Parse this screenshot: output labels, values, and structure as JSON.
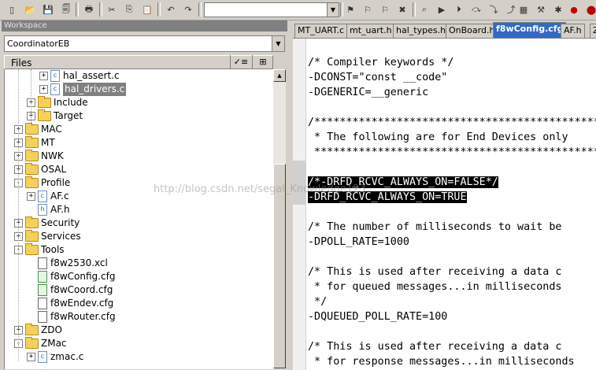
{
  "toolbar": {
    "icons": [
      "new-file",
      "open-folder",
      "save",
      "save-all",
      "print",
      "cut",
      "copy",
      "paste",
      "undo",
      "redo",
      "dropdown",
      "bookmark-toggle",
      "bookmark-next",
      "bookmark-prev",
      "bookmark-clear",
      "find",
      "go",
      "go-next",
      "step",
      "step-into",
      "step-out",
      "compile",
      "make",
      "debug",
      "stop",
      "breakpoint"
    ],
    "search_value": ""
  },
  "workspace": {
    "title": "Workspace",
    "project": "CoordinatorEB",
    "files_header": "Files",
    "tree": [
      {
        "label": "hal_assert.c",
        "kind": "c-file",
        "depth": 3,
        "expander": "+"
      },
      {
        "label": "hal_drivers.c",
        "kind": "c-file",
        "depth": 3,
        "expander": "+",
        "selected": true
      },
      {
        "label": "Include",
        "kind": "folder",
        "depth": 2,
        "expander": "+"
      },
      {
        "label": "Target",
        "kind": "folder",
        "depth": 2,
        "expander": "+"
      },
      {
        "label": "MAC",
        "kind": "folder",
        "depth": 1,
        "expander": "+"
      },
      {
        "label": "MT",
        "kind": "folder",
        "depth": 1,
        "expander": "+"
      },
      {
        "label": "NWK",
        "kind": "folder",
        "depth": 1,
        "expander": "+"
      },
      {
        "label": "OSAL",
        "kind": "folder",
        "depth": 1,
        "expander": "+"
      },
      {
        "label": "Profile",
        "kind": "folder",
        "depth": 1,
        "expander": "-"
      },
      {
        "label": "AF.c",
        "kind": "c-file",
        "depth": 2,
        "expander": "+"
      },
      {
        "label": "AF.h",
        "kind": "h-file",
        "depth": 2,
        "expander": ""
      },
      {
        "label": "Security",
        "kind": "folder",
        "depth": 1,
        "expander": "+"
      },
      {
        "label": "Services",
        "kind": "folder",
        "depth": 1,
        "expander": "+"
      },
      {
        "label": "Tools",
        "kind": "folder",
        "depth": 1,
        "expander": "-"
      },
      {
        "label": "f8w2530.xcl",
        "kind": "xcl-file",
        "depth": 2,
        "expander": ""
      },
      {
        "label": "f8wConfig.cfg",
        "kind": "cfg-file",
        "depth": 2,
        "expander": ""
      },
      {
        "label": "f8wCoord.cfg",
        "kind": "cfg-file",
        "depth": 2,
        "expander": ""
      },
      {
        "label": "f8wEndev.cfg",
        "kind": "x-file",
        "depth": 2,
        "expander": ""
      },
      {
        "label": "f8wRouter.cfg",
        "kind": "x-file",
        "depth": 2,
        "expander": ""
      },
      {
        "label": "ZDO",
        "kind": "folder",
        "depth": 1,
        "expander": "+"
      },
      {
        "label": "ZMac",
        "kind": "folder",
        "depth": 1,
        "expander": "-"
      },
      {
        "label": "zmac.c",
        "kind": "c-file",
        "depth": 2,
        "expander": "+"
      }
    ]
  },
  "editor": {
    "tabs": [
      {
        "label": "MT_UART.c",
        "active": false
      },
      {
        "label": "mt_uart.h",
        "active": false
      },
      {
        "label": "hal_types.h",
        "active": false
      },
      {
        "label": "OnBoard.h",
        "active": false
      },
      {
        "label": "f8wConfig.cfg",
        "active": true
      },
      {
        "label": "AF.h",
        "active": false
      },
      {
        "label": "ZM",
        "active": false
      }
    ],
    "lines": [
      {
        "text": "/* Compiler keywords */",
        "hl": false
      },
      {
        "text": "-DCONST=\"const __code\"",
        "hl": false
      },
      {
        "text": "-DGENERIC=__generic",
        "hl": false
      },
      {
        "text": "",
        "hl": false
      },
      {
        "text": "/**********************************************",
        "hl": false
      },
      {
        "text": " * The following are for End Devices only",
        "hl": false
      },
      {
        "text": " **********************************************",
        "hl": false
      },
      {
        "text": "",
        "hl": false
      },
      {
        "text": "/*-DRFD_RCVC_ALWAYS_ON=FALSE*/",
        "hl": true
      },
      {
        "text": "-DRFD_RCVC_ALWAYS_ON=TRUE",
        "hl": true
      },
      {
        "text": "",
        "hl": false
      },
      {
        "text": "/* The number of milliseconds to wait be",
        "hl": false
      },
      {
        "text": "-DPOLL_RATE=1000",
        "hl": false
      },
      {
        "text": "",
        "hl": false
      },
      {
        "text": "/* This is used after receiving a data c",
        "hl": false
      },
      {
        "text": " * for queued messages...in milliseconds",
        "hl": false
      },
      {
        "text": " */",
        "hl": false
      },
      {
        "text": "-DQUEUED_POLL_RATE=100",
        "hl": false
      },
      {
        "text": "",
        "hl": false
      },
      {
        "text": "/* This is used after receiving a data c",
        "hl": false
      },
      {
        "text": " * for response messages...in milliseconds",
        "hl": false
      }
    ],
    "watermark": "http://blog.csdn.net/segal_Knowledge123"
  }
}
